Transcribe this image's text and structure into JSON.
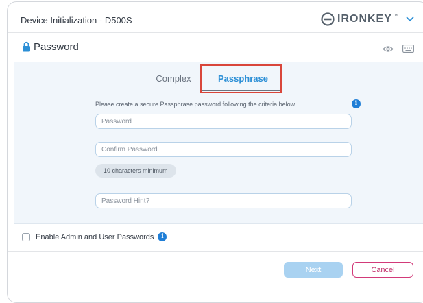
{
  "window": {
    "title": "Device Initialization - D500S"
  },
  "brand": {
    "name": "IRONKEY",
    "trademark": "™",
    "icon": "ironkey-logo-icon",
    "menu_icon": "chevron-down-icon"
  },
  "section": {
    "title": "Password",
    "icon": "lock-icon",
    "actions": [
      "eye-icon",
      "keyboard-icon"
    ]
  },
  "tabs": [
    {
      "label": "Complex",
      "active": false
    },
    {
      "label": "Passphrase",
      "active": true
    }
  ],
  "form": {
    "instruction": "Please create a secure Passphrase password following the criteria below.",
    "password_placeholder": "Password",
    "confirm_placeholder": "Confirm Password",
    "requirement_badge": "10 characters minimum",
    "hint_placeholder": "Password Hint?"
  },
  "options": {
    "admin_user_label": "Enable Admin and User Passwords",
    "admin_user_checked": false
  },
  "buttons": {
    "next": "Next",
    "cancel": "Cancel"
  },
  "colors": {
    "accent": "#2c8fd6",
    "info": "#1f7ed6",
    "highlight": "#d9463b",
    "next_disabled": "#a9d2f1",
    "cancel": "#d23a79"
  }
}
